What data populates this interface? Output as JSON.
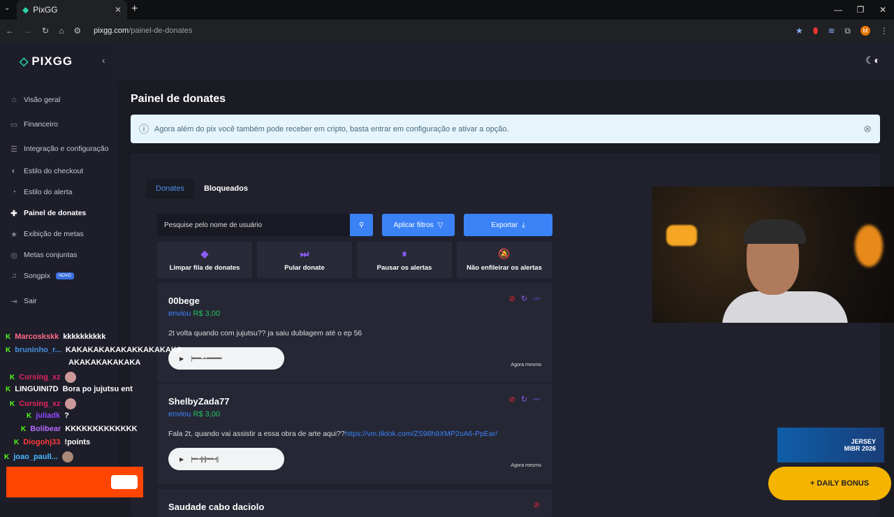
{
  "browser": {
    "tab_title": "PixGG",
    "url_domain": "pixgg.com",
    "url_path": "/painel-de-donates",
    "profile_initial": "M"
  },
  "sidebar": {
    "logo": "PIXGG",
    "items": [
      {
        "label": "Visão geral",
        "icon": "home-icon"
      },
      {
        "label": "Financeiro",
        "icon": "wallet-icon"
      },
      {
        "label": "Integração e configuração",
        "icon": "settings-icon"
      },
      {
        "label": "Estilo do checkout",
        "icon": "palette-icon"
      },
      {
        "label": "Estilo do alerta",
        "icon": "bell-icon"
      },
      {
        "label": "Painel de donates",
        "icon": "donate-icon",
        "active": true
      },
      {
        "label": "Exibição de metas",
        "icon": "star-icon"
      },
      {
        "label": "Metas conjuntas",
        "icon": "target-icon"
      },
      {
        "label": "Songpix",
        "icon": "music-icon",
        "badge": "NOVO"
      },
      {
        "label": "Sair",
        "icon": "logout-icon"
      }
    ]
  },
  "page": {
    "title": "Painel de donates",
    "alert": "Agora além do pix você também pode receber em cripto, basta entrar em configuração e ativar a opção."
  },
  "tabs": {
    "donates": "Donates",
    "bloqueados": "Bloqueados"
  },
  "toolbar": {
    "search_placeholder": "Pesquise pelo nome de usuário",
    "filter": "Aplicar filtros",
    "export": "Exportar"
  },
  "actions": [
    "Limpar fila de donates",
    "Pular donate",
    "Pausar os alertas",
    "Não enfileirar os alertas"
  ],
  "donates": [
    {
      "name": "00bege",
      "sent": "enviou",
      "amount": "R$ 3,00",
      "message": "2t volta quando com jujutsu?? ja saiu dublagem até o ep 56",
      "link": "",
      "time": "Agora mesmo"
    },
    {
      "name": "ShelbyZada77",
      "sent": "enviou",
      "amount": "R$ 3,00",
      "message": "Fala 2t, quando vai assistir a essa obra de arte aqui??",
      "link": "https://vm.tiktok.com/ZS98h9XMP2oA6-PpEar/",
      "time": "Agora mesmo"
    },
    {
      "name": "Saudade cabo daciolo"
    }
  ],
  "chat": [
    {
      "user": "Marcoskskk",
      "color": "#ff6b8a",
      "msg": "kkkkkkkkkk"
    },
    {
      "user": "bruninho_r...",
      "color": "#4a90e2",
      "msg": "KAKAKAKAKAKAKKAKAKAKA"
    },
    {
      "user": "",
      "color": "",
      "msg": "AKAKAKAKAKAKA"
    },
    {
      "user": "Cursing_xz",
      "color": "#e0245e",
      "msg": ""
    },
    {
      "user": "LINGUINI7D",
      "color": "#ffffff",
      "msg": "Bora po jujutsu ent"
    },
    {
      "user": "Cursing_xz",
      "color": "#e0245e",
      "msg": ""
    },
    {
      "user": "juliadk",
      "color": "#9146ff",
      "msg": "?"
    },
    {
      "user": "Bolibear",
      "color": "#b36bff",
      "msg": "KKKKKKKKKKKKK"
    },
    {
      "user": "Diogohj33",
      "color": "#ff3b3b",
      "msg": "!points"
    },
    {
      "user": "joao_paull...",
      "color": "#4ab8ff",
      "msg": ""
    }
  ],
  "overlay": {
    "jersey_line1": "JERSEY",
    "jersey_line2": "MIBR 2026",
    "bonus": "+ DAILY BONUS"
  }
}
